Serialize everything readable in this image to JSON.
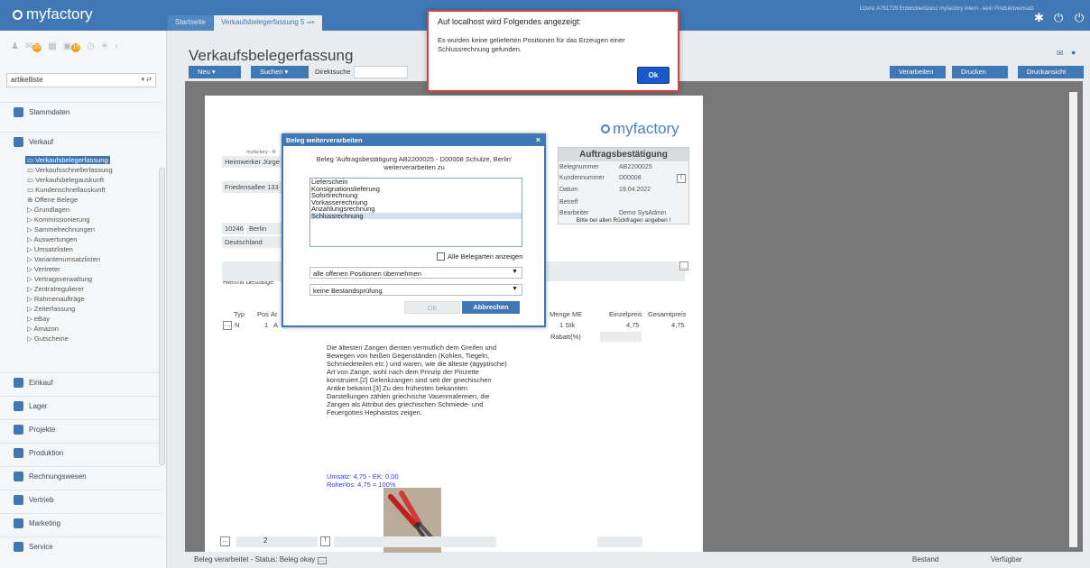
{
  "app": {
    "logo_text": "myfactory",
    "license_text": "Lizenz A761729 Entwicklerlizenz myfactory intern - kein Produktiveinsatz",
    "tabs": [
      {
        "label": "Startseite"
      },
      {
        "label": "Verkaufsbelegerfassung 5"
      }
    ]
  },
  "sidebar": {
    "icon_badges": [
      "20",
      "15"
    ],
    "search_value": "artikelliste",
    "sections": {
      "stammdaten": "Stammdaten",
      "verkauf": "Verkauf",
      "einkauf": "Einkauf",
      "lager": "Lager",
      "projekte": "Projekte",
      "produktion": "Produktion",
      "rechnungswesen": "Rechnungswesen",
      "vertrieb": "Vertrieb",
      "marketing": "Marketing",
      "service": "Service"
    },
    "verkauf_items": [
      "Verkaufsbelegerfassung",
      "Verkaufsschnellerfassung",
      "Verkaufsbelegauskunft",
      "Kundenschnellauskunft",
      "Offene Belege",
      "Grundlagen",
      "Kommissionierung",
      "Sammelrechnungen",
      "Auswertungen",
      "Umsatzlisten",
      "Variantenumsatzlisten",
      "Vertreter",
      "Vertragsverwaltung",
      "Zentralregulierer",
      "Rahmenaufträge",
      "Zeiterfassung",
      "eBay",
      "Amazon",
      "Gutscheine"
    ]
  },
  "main": {
    "title": "Verkaufsbelegerfassung",
    "toolbar": {
      "new": "Neu",
      "search": "Suchen",
      "direct_search": "Direktsuche",
      "process": "Verarbeiten",
      "print": "Drucken",
      "print_view": "Druckansicht"
    }
  },
  "document": {
    "logo_text": "myfactory",
    "sender_line": "myfactory - R",
    "customer_name": "Heimwerker Jürge",
    "street": "Friedensallee 133",
    "zip": "10246",
    "city": "Berlin",
    "country": "Deutschland",
    "intro": "Hiermit bestätige",
    "order_box": {
      "title": "Auftragsbestätigung",
      "labels": [
        "Belegnummer",
        "Kundennummer",
        "Datum",
        "Betreff",
        "Bearbeiter"
      ],
      "values": [
        "AB2200025",
        "D00008",
        "19.04.2022",
        "",
        "Demo SysAdmin"
      ],
      "note": "Bitte bei allen Rückfragen angeben !"
    },
    "table_headers": [
      "Typ",
      "Pos",
      "Ar",
      "Menge ME",
      "Einzelpreis",
      "Gesamtpreis"
    ],
    "row": {
      "type": "N",
      "pos": "1",
      "article": "A",
      "qty": "1 Stk",
      "unit_price": "4,75",
      "total": "4,75",
      "discount_label": "Rabatt(%)"
    },
    "long_text": "Die ältesten Zangen dienten vermutlich dem Greifen und Bewegen von heißen Gegenständen (Kohlen, Tiegeln, Schmiedeteilen etc.) und waren, wie die älteste (ägyptische) Art von Zange, wohl nach dem Prinzip der Pinzette konstruiert.[2] Gelenkzangen sind seit der griechischen Antike bekannt.[3] Zu den frühesten bekannten Darstellungen zählen griechische Vasenmalereien, die Zangen als Attribut des griechischen Schmiede- und Feuergottes Hephaistos zeigen.",
    "margin_line1": "Umsatz: 4,75 - EK: 0,00",
    "margin_line2": "Roherlös: 4,75 = 100%",
    "pager_value": "2"
  },
  "status": {
    "text": "Beleg verarbeitet - Status: Beleg okay",
    "bestand": "Bestand",
    "verfuegbar": "Verfügbar"
  },
  "dialog": {
    "title": "Beleg weiterverarbeiten",
    "message": "Beleg 'Auftragsbestätigung AB2200025 - D00008 Schulze, Berlin' weiterverarbeiten zu",
    "options": [
      "Lieferschein",
      "Konsignationslieferung",
      "Sofortrechnung",
      "Vorkasserechnung",
      "Anzahlungsrechnung",
      "Schlussrechnung"
    ],
    "selected_index": 5,
    "show_all_label": "Alle Belegarten anzeigen",
    "positions_select": "alle offenen Positionen übernehmen",
    "stock_select": "keine Bestandsprüfung",
    "ok": "OK",
    "cancel": "Abbrechen"
  },
  "alert": {
    "title": "Auf localhost wird Folgendes angezeigt:",
    "message": "Es wurden keine gelieferten Positionen für das Erzeugen einer Schlussrechnung gefunden.",
    "ok": "Ok"
  }
}
